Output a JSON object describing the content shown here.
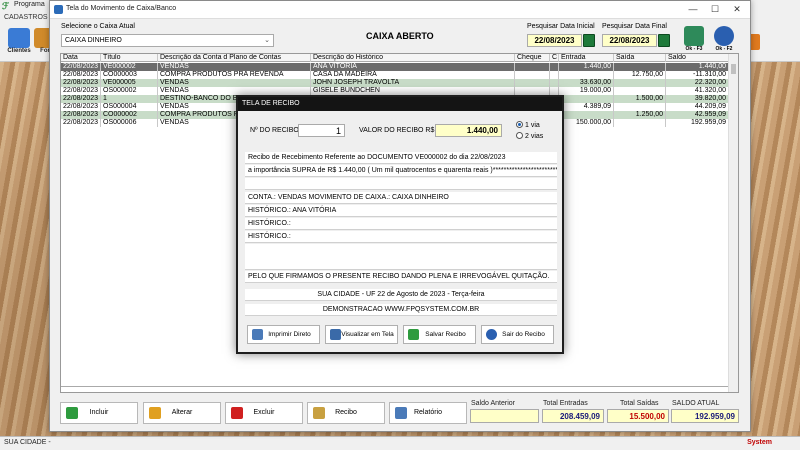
{
  "back_app": {
    "title": "Programa ",
    "menu": "CADASTROS",
    "tools": [
      {
        "label": "Clientes",
        "icon": "clients-icon",
        "color": "#3a7bd5"
      },
      {
        "label": "For",
        "icon": "suppliers-icon",
        "color": "#d08a2a"
      }
    ],
    "footer_left": "SUA CIDADE - ",
    "footer_right": "System"
  },
  "window": {
    "title": "Tela do Movimento de Caixa/Banco",
    "caixa_label": "Selecione o Caixa Atual",
    "caixa_value": "CAIXA DINHEIRO",
    "status": "CAIXA ABERTO",
    "data_inicial_label": "Pesquisar Data Inicial",
    "data_inicial": "22/08/2023",
    "data_final_label": "Pesquisar Data Final",
    "data_final": "22/08/2023",
    "btn1_label": "Ok - F3",
    "btn2_label": "Ok - F2"
  },
  "grid": {
    "headers": [
      "Data",
      "Título",
      "Descrição da Conta d Plano de Contas",
      "Descrição do Histórico",
      "Cheque",
      "C",
      "Entrada",
      "Saída",
      "Saldo"
    ],
    "rows": [
      {
        "style": "s",
        "cells": [
          "22/08/2023",
          "VE000002",
          "VENDAS",
          "ANA VITÓRIA",
          "",
          "",
          "1.440,00",
          "",
          "1.440,00"
        ]
      },
      {
        "style": "w",
        "cells": [
          "22/08/2023",
          "CO000003",
          "COMPRA PRODUTOS PRA REVENDA",
          "CASA DA MADEIRA",
          "",
          "",
          "",
          "12.750,00",
          "-11.310,00"
        ]
      },
      {
        "style": "g",
        "cells": [
          "22/08/2023",
          "VE000005",
          "VENDAS",
          "JOHN JOSEPH TRAVOLTA",
          "",
          "",
          "33.630,00",
          "",
          "22.320,00"
        ]
      },
      {
        "style": "w",
        "cells": [
          "22/08/2023",
          "OS000002",
          "VENDAS",
          "GISELE BUNDCHEN",
          "",
          "",
          "19.000,00",
          "",
          "41.320,00"
        ]
      },
      {
        "style": "g",
        "cells": [
          "22/08/2023",
          "1",
          "DESTINO-BANCO DO BRASIL",
          "",
          "",
          "",
          "",
          "1.500,00",
          "39.820,00"
        ]
      },
      {
        "style": "w",
        "cells": [
          "22/08/2023",
          "OS000004",
          "VENDAS",
          "",
          "",
          "",
          "4.389,09",
          "",
          "44.209,09"
        ]
      },
      {
        "style": "g",
        "cells": [
          "22/08/2023",
          "CO000002",
          "COMPRA PRODUTOS PRA",
          "",
          "",
          "",
          "",
          "1.250,00",
          "42.959,09"
        ]
      },
      {
        "style": "w",
        "cells": [
          "22/08/2023",
          "OS000006",
          "VENDAS",
          "",
          "",
          "",
          "150.000,00",
          "",
          "192.959,09"
        ]
      }
    ]
  },
  "bottom_buttons": [
    {
      "label": "Incluir",
      "name": "incluir-button",
      "icon": "add-icon",
      "color": "#2e9b3e"
    },
    {
      "label": "Alterar",
      "name": "alterar-button",
      "icon": "edit-icon",
      "color": "#e0a020"
    },
    {
      "label": "Excluir",
      "name": "excluir-button",
      "icon": "delete-icon",
      "color": "#d02020"
    },
    {
      "label": "Recibo",
      "name": "recibo-button",
      "icon": "receipt-icon",
      "color": "#c8a040"
    },
    {
      "label": "Relatório",
      "name": "relatorio-button",
      "icon": "printer-icon",
      "color": "#4a7ab8"
    }
  ],
  "totals": {
    "saldo_anterior_label": "Saldo Anterior",
    "saldo_anterior": "",
    "total_entradas_label": "Total Entradas",
    "total_entradas": "208.459,09",
    "total_saidas_label": "Total Saídas",
    "total_saidas": "15.500,00",
    "saldo_atual_label": "SALDO ATUAL",
    "saldo_atual": "192.959,09",
    "entradas_color": "#1a1a7a",
    "saidas_color": "#c00000"
  },
  "dialog": {
    "title": "TELA DE RECIBO",
    "nro_label": "Nº DO RECIBO",
    "nro_value": "1",
    "valor_label": "VALOR DO RECIBO R$",
    "valor_value": "1.440,00",
    "via1": "1 via",
    "via2": "2 vias",
    "lines": {
      "l1": "Recibo de Recebimento Referente ao DOCUMENTO VE000002    do dia 22/08/2023",
      "l2": "a importância SUPRA de R$     1.440,00 ( Um mil quatrocentos e quarenta  reais )*****************************",
      "l3": "",
      "l4": "CONTA.: VENDAS                    MOVIMENTO DE CAIXA.: CAIXA DINHEIRO",
      "l5": "HISTÓRICO.: ANA VITÓRIA",
      "l6": "HISTÓRICO.:",
      "l7": "HISTÓRICO.:",
      "l8": "",
      "l9": "PELO QUE FIRMAMOS O PRESENTE RECIBO DANDO PLENA E IRREVOGÁVEL QUITAÇÃO.",
      "l10": "SUA CIDADE - UF 22 de Agosto de 2023 - Terça-feira",
      "l11": "DEMONSTRACAO WWW.FPQSYSTEM.COM.BR"
    },
    "buttons": [
      {
        "label": "Imprimir Direto",
        "name": "imprimir-direto-button",
        "icon": "printer-icon",
        "color": "#4a7ab8"
      },
      {
        "label": "Visualizar em Tela",
        "name": "visualizar-tela-button",
        "icon": "monitor-icon",
        "color": "#3a6aa8"
      },
      {
        "label": "Salvar Recibo",
        "name": "salvar-recibo-button",
        "icon": "check-icon",
        "color": "#2e9b3e"
      },
      {
        "label": "Sair do Recibo",
        "name": "sair-recibo-button",
        "icon": "exit-icon",
        "color": "#2a5fb0"
      }
    ]
  }
}
